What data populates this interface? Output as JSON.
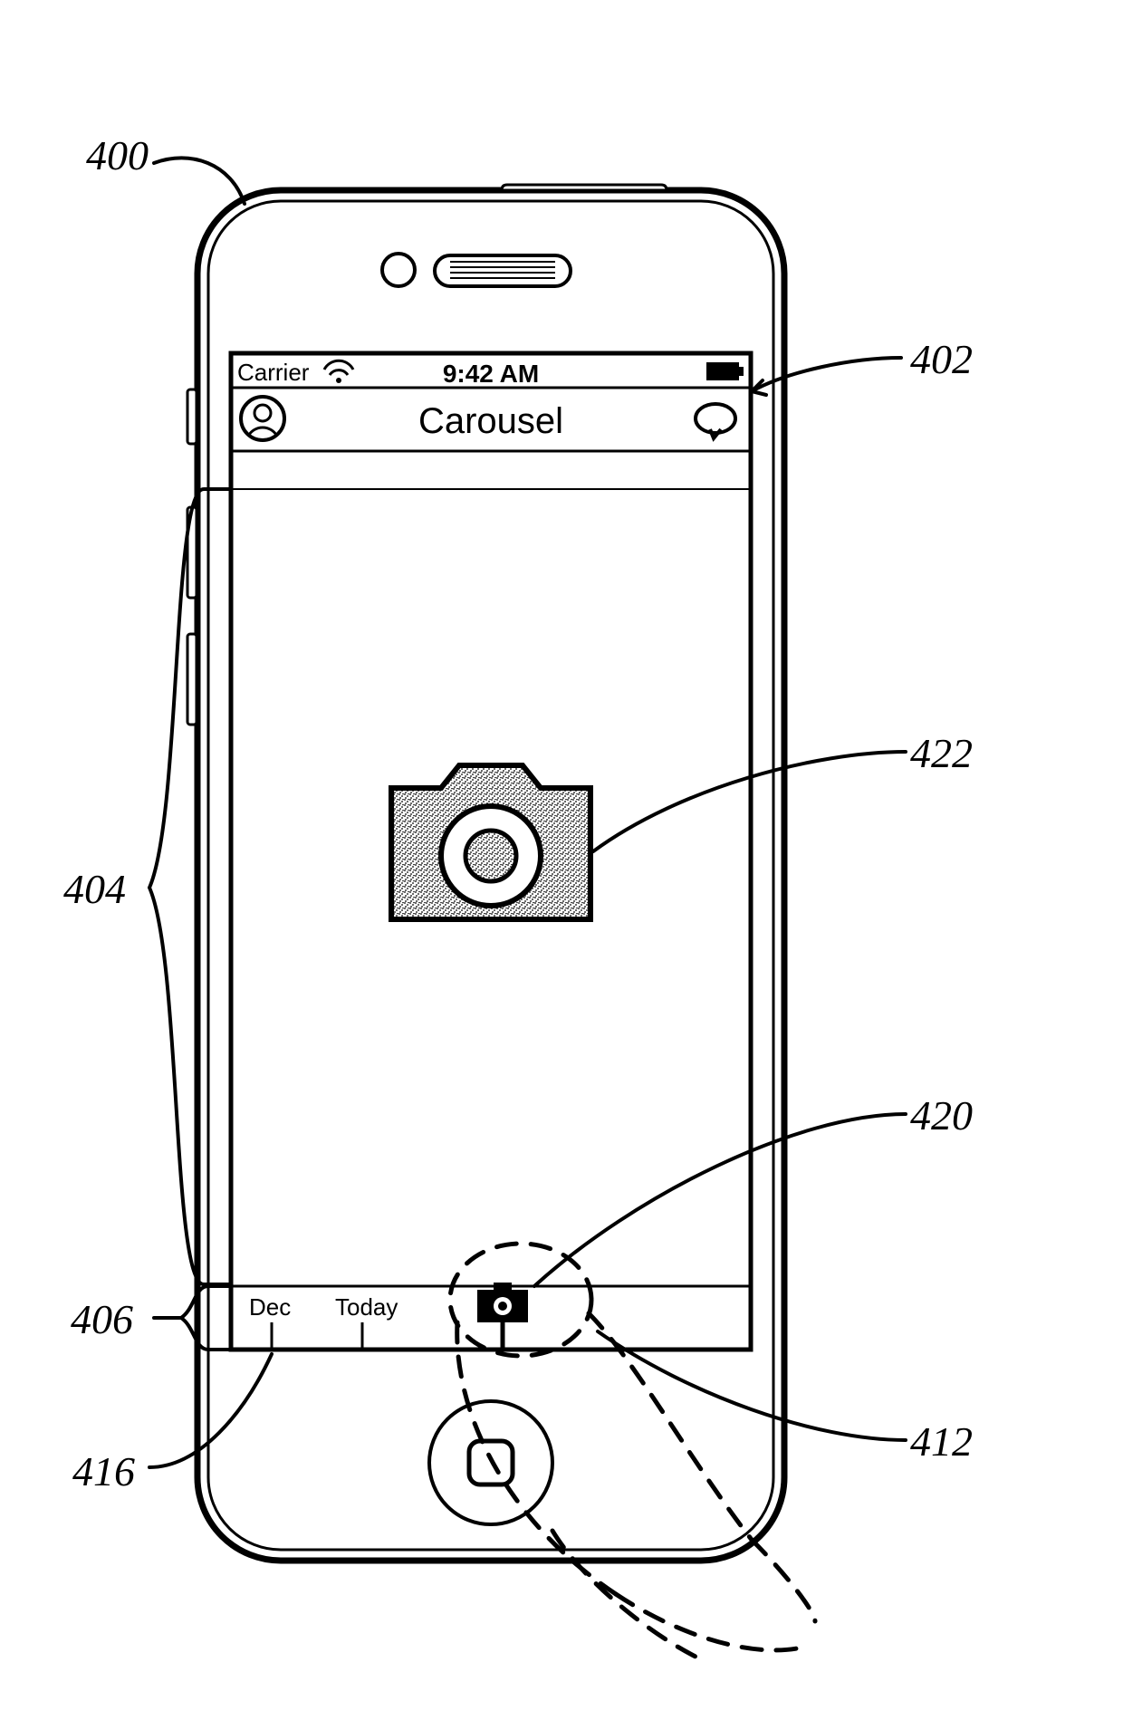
{
  "status_bar": {
    "carrier": "Carrier",
    "time": "9:42 AM"
  },
  "nav_bar": {
    "title": "Carousel"
  },
  "timeline": {
    "month": "Dec",
    "today": "Today"
  },
  "refs": {
    "r400": "400",
    "r402": "402",
    "r404": "404",
    "r406": "406",
    "r412": "412",
    "r416": "416",
    "r420": "420",
    "r422": "422"
  }
}
